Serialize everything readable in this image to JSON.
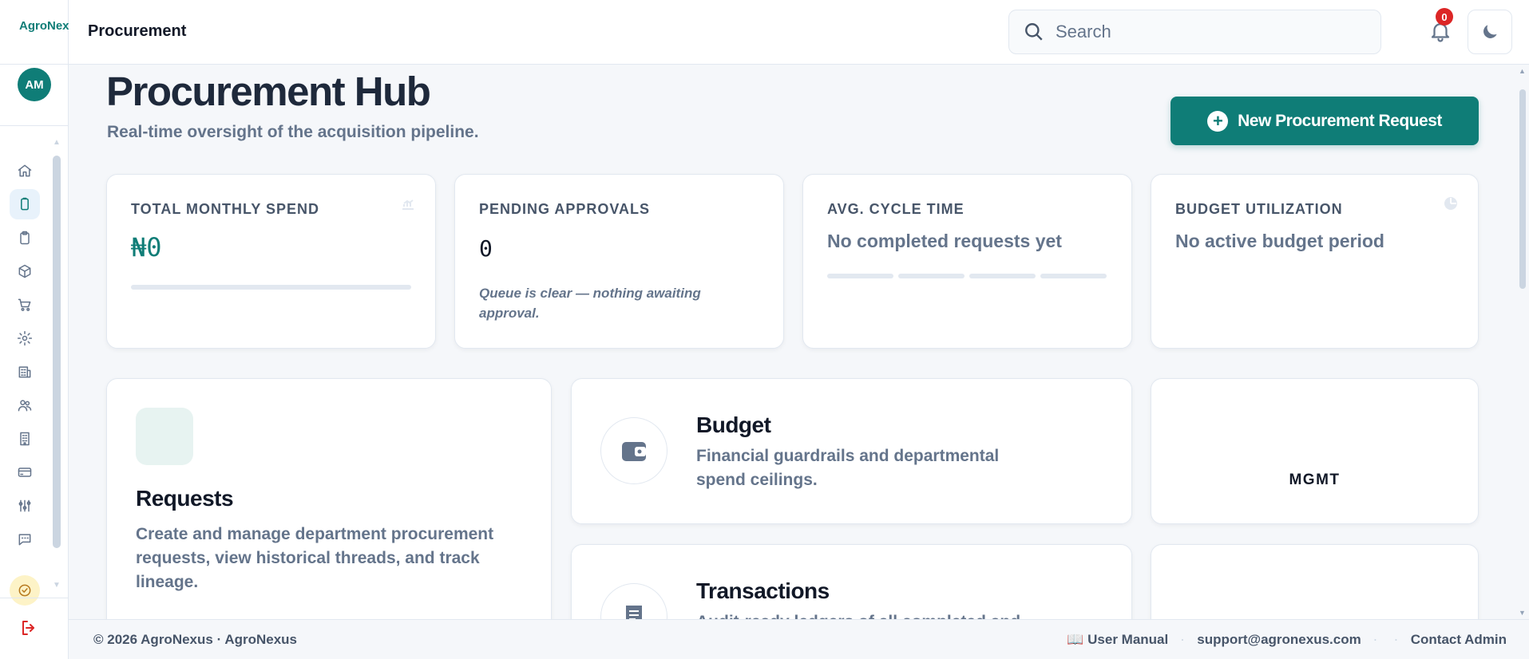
{
  "brand": {
    "name": "AgroNexus",
    "avatar_initials": "AM"
  },
  "header": {
    "title": "Procurement",
    "search_placeholder": "Search",
    "notification_count": "0"
  },
  "page": {
    "title": "Procurement Hub",
    "subtitle": "Real-time oversight of the acquisition pipeline.",
    "primary_action": "New Procurement Request"
  },
  "kpis": {
    "spend": {
      "label": "TOTAL MONTHLY SPEND",
      "value": "₦0"
    },
    "approvals": {
      "label": "PENDING APPROVALS",
      "value": "0",
      "note": "Queue is clear — nothing awaiting approval."
    },
    "cycle": {
      "label": "AVG. CYCLE TIME",
      "value": "No completed requests yet"
    },
    "budget": {
      "label": "BUDGET UTILIZATION",
      "value": "No active budget period"
    }
  },
  "modules": {
    "requests": {
      "title": "Requests",
      "description": "Create and manage department procurement requests, view historical threads, and track lineage."
    },
    "budget": {
      "title": "Budget",
      "description": "Financial guardrails and departmental spend ceilings."
    },
    "transactions": {
      "title": "Transactions",
      "description": "Audit-ready ledgers of all completed and"
    },
    "mgmt": {
      "label": "MGMT"
    }
  },
  "sidebar": {
    "icons": [
      "home-icon",
      "procurement-icon",
      "clipboard-icon",
      "box-icon",
      "cart-icon",
      "gear-icon",
      "building-chart-icon",
      "users-icon",
      "office-building-icon",
      "credit-card-icon",
      "sliders-icon",
      "chat-icon",
      "check-circle-icon"
    ]
  },
  "footer": {
    "copyright": "© 2026 AgroNexus · AgroNexus",
    "manual": "📖 User Manual",
    "email": "support@agronexus.com",
    "contact": "Contact Admin"
  },
  "colors": {
    "accent": "#0f7d77",
    "danger": "#dc2626",
    "text": "#1e293b",
    "muted": "#64748b"
  }
}
